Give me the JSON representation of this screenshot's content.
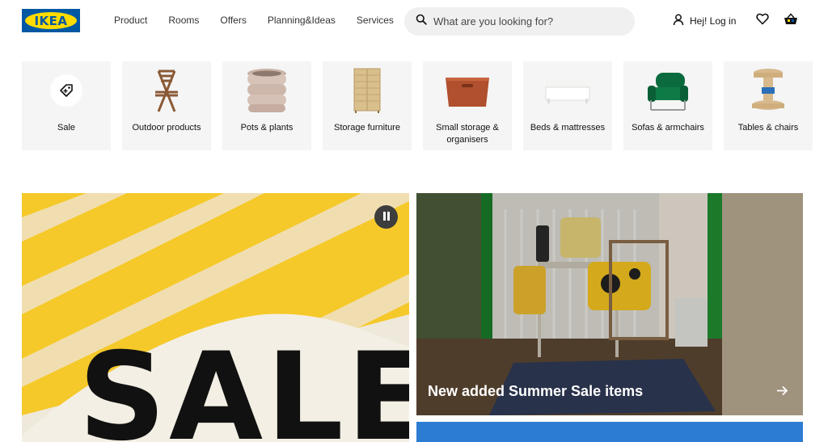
{
  "header": {
    "logo_text": "IKEA",
    "nav": [
      "Product",
      "Rooms",
      "Offers",
      "Planning&Ideas",
      "Services"
    ],
    "search_placeholder": "What are you looking for?",
    "login_label": "Hej! Log in",
    "icons": [
      "search-icon",
      "person-icon",
      "heart-icon",
      "basket-icon"
    ]
  },
  "categories": [
    {
      "label": "Sale"
    },
    {
      "label": "Outdoor products"
    },
    {
      "label": "Pots & plants"
    },
    {
      "label": "Storage furniture"
    },
    {
      "label": "Small storage & organisers"
    },
    {
      "label": "Beds & mattresses"
    },
    {
      "label": "Sofas & armchairs"
    },
    {
      "label": "Tables & chairs"
    }
  ],
  "hero": {
    "left_text": "SALE",
    "right_caption": "New added Summer Sale items"
  },
  "colors": {
    "brand_blue": "#0058a3",
    "brand_yellow": "#ffdb00",
    "tile_bg": "#f5f5f5"
  }
}
